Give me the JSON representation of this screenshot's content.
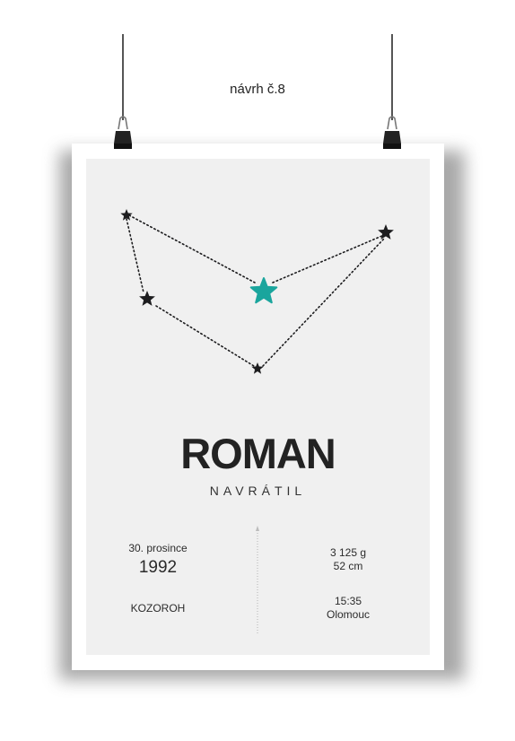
{
  "caption": "návrh č.8",
  "poster": {
    "first_name": "ROMAN",
    "last_name": "NAVRÁTIL",
    "date_day": "30. prosince",
    "date_year": "1992",
    "weight": "3 125 g",
    "length": "52 cm",
    "zodiac": "KOZOROH",
    "time": "15:35",
    "place": "Olomouc"
  },
  "colors": {
    "accent_star": "#1aa59d",
    "stars": "#1d1d1f"
  }
}
